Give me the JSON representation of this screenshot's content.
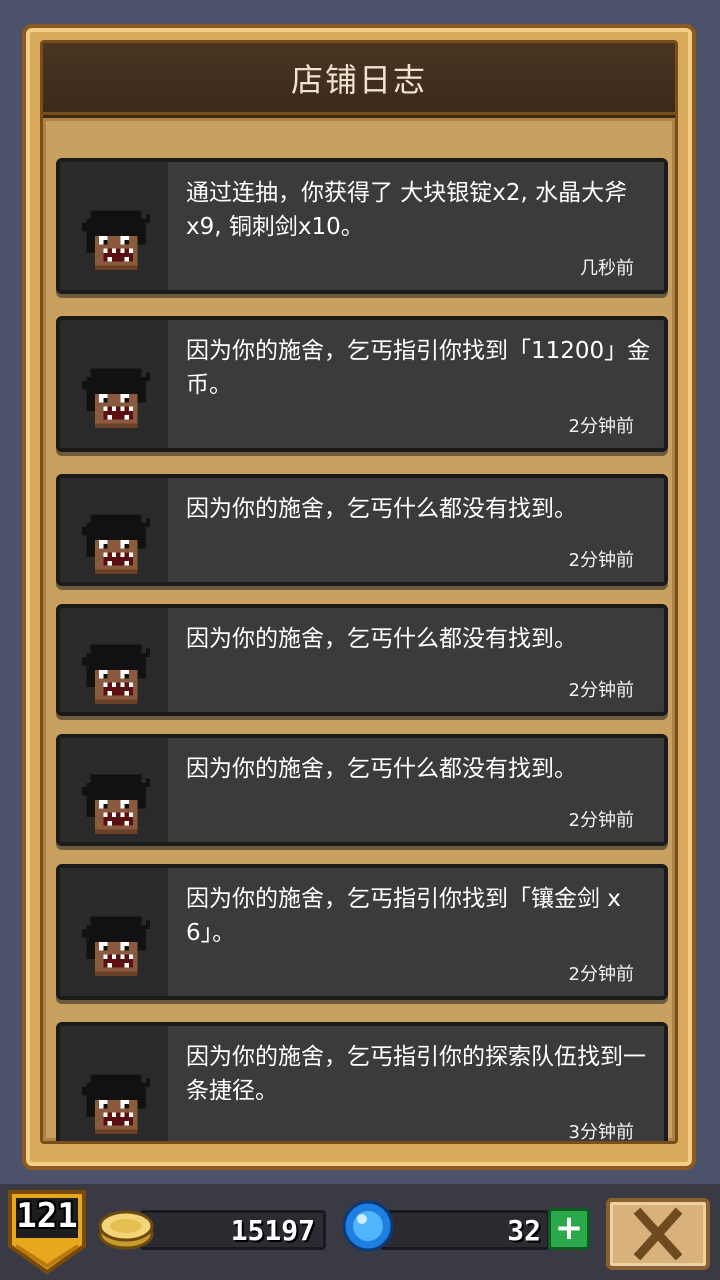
{
  "panel": {
    "title": "店铺日志"
  },
  "logs": [
    {
      "message": "通过连抽，你获得了 大块银锭x2, 水晶大斧x9, 铜刺剑x10。",
      "time": "几秒前"
    },
    {
      "message": "因为你的施舍，乞丐指引你找到「11200」金币。",
      "time": "2分钟前"
    },
    {
      "message": "因为你的施舍，乞丐什么都没有找到。",
      "time": "2分钟前"
    },
    {
      "message": "因为你的施舍，乞丐什么都没有找到。",
      "time": "2分钟前"
    },
    {
      "message": "因为你的施舍，乞丐什么都没有找到。",
      "time": "2分钟前"
    },
    {
      "message": "因为你的施舍，乞丐指引你找到「镶金剑 x 6」。",
      "time": "2分钟前"
    },
    {
      "message": "因为你的施舍，乞丐指引你的探索队伍找到一条捷径。",
      "time": "3分钟前"
    }
  ],
  "status": {
    "level": "121",
    "gold": "15197",
    "gems": "32",
    "plus_label": "+"
  },
  "icons": {
    "avatar": "beggar-avatar-icon",
    "coin": "gold-coin-icon",
    "gem": "blue-gem-icon",
    "close": "close-icon",
    "level": "level-shield-icon"
  }
}
